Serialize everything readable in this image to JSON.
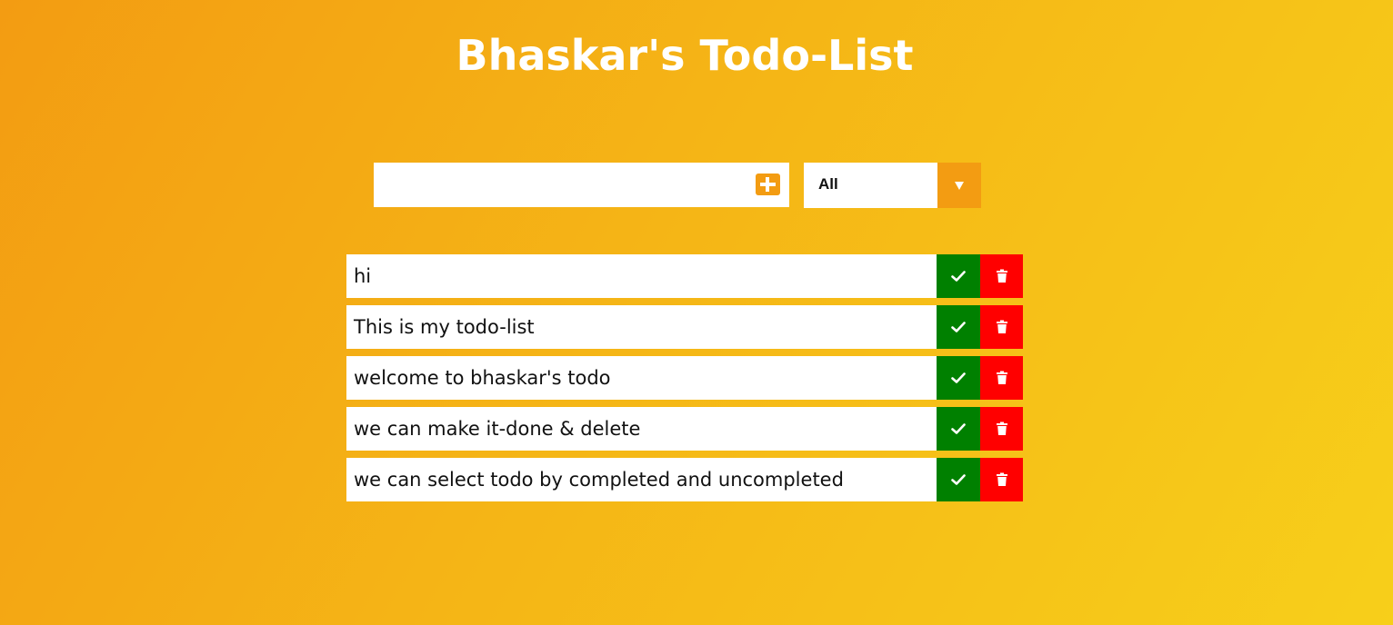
{
  "header": {
    "title": "Bhaskar's Todo-List"
  },
  "form": {
    "input_value": "",
    "add_icon": "plus-square-icon"
  },
  "filter": {
    "selected": "All",
    "arrow_icon": "caret-down-icon"
  },
  "todos": [
    {
      "text": "hi",
      "done_icon": "check-icon",
      "delete_icon": "trash-icon"
    },
    {
      "text": "This is my todo-list",
      "done_icon": "check-icon",
      "delete_icon": "trash-icon"
    },
    {
      "text": "welcome to bhaskar's todo",
      "done_icon": "check-icon",
      "delete_icon": "trash-icon"
    },
    {
      "text": "we can make it-done & delete",
      "done_icon": "check-icon",
      "delete_icon": "trash-icon"
    },
    {
      "text": "we can select todo by completed and uncompleted",
      "done_icon": "check-icon",
      "delete_icon": "trash-icon"
    }
  ],
  "colors": {
    "accent": "#f39c12",
    "done": "#008000",
    "delete": "#ff0000"
  }
}
